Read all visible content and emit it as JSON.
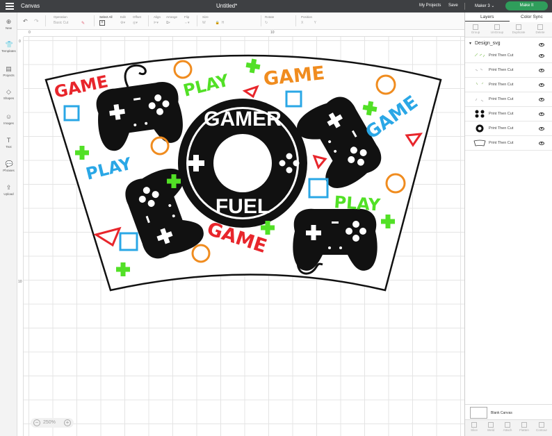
{
  "header": {
    "app_name": "Canvas",
    "document_title": "Untitled*",
    "my_projects": "My Projects",
    "save": "Save",
    "machine": "Maker 3",
    "make_it": "Make It"
  },
  "sidebar": {
    "items": [
      {
        "label": "New",
        "icon": "plus-icon"
      },
      {
        "label": "Templates",
        "icon": "shirt-icon"
      },
      {
        "label": "Projects",
        "icon": "folder-icon"
      },
      {
        "label": "Shapes",
        "icon": "shapes-icon"
      },
      {
        "label": "Images",
        "icon": "image-icon"
      },
      {
        "label": "Text",
        "icon": "text-icon"
      },
      {
        "label": "Phrases",
        "icon": "speech-bubble-icon"
      },
      {
        "label": "Upload",
        "icon": "upload-icon"
      }
    ]
  },
  "toolbar": {
    "operation_label": "Operation",
    "operation_value": "Basic Cut",
    "select_all": "Select All",
    "edit": "Edit",
    "offset": "Offset",
    "align": "Align",
    "arrange": "Arrange",
    "flip": "Flip",
    "size": "Size",
    "rotate": "Rotate",
    "position": "Position",
    "w": "W",
    "h": "H",
    "x": "X",
    "y": "Y"
  },
  "ruler": {
    "top_marks": [
      "0",
      "10"
    ],
    "left_marks": [
      "0",
      "10"
    ]
  },
  "zoom": {
    "value": "250%"
  },
  "design": {
    "center_top": "GAMER",
    "center_bottom": "FUEL",
    "words": [
      {
        "text": "GAME",
        "color": "#e8262c"
      },
      {
        "text": "PLAY",
        "color": "#52e026"
      },
      {
        "text": "GAME",
        "color": "#f08c1f"
      },
      {
        "text": "GAME",
        "color": "#2aa7e6"
      },
      {
        "text": "PLAY",
        "color": "#2aa7e6"
      },
      {
        "text": "PLAY",
        "color": "#52e026"
      },
      {
        "text": "GAME",
        "color": "#e8262c"
      }
    ],
    "colors": {
      "red": "#e8262c",
      "green": "#52e026",
      "orange": "#f08c1f",
      "blue": "#2aa7e6",
      "black": "#111111"
    }
  },
  "panel": {
    "tabs": [
      "Layers",
      "Color Sync"
    ],
    "layer_tools": [
      "Group",
      "UnGroup",
      "Duplicate",
      "Delete"
    ],
    "group_name": "Design_svg",
    "layers": [
      {
        "name": "Print Then Cut",
        "thumb": "thin-strokes"
      },
      {
        "name": "Print Then Cut",
        "thumb": "thin-strokes"
      },
      {
        "name": "Print Then Cut",
        "thumb": "thin-strokes"
      },
      {
        "name": "Print Then Cut",
        "thumb": "thin-strokes"
      },
      {
        "name": "Print Then Cut",
        "thumb": "controllers"
      },
      {
        "name": "Print Then Cut",
        "thumb": "ring"
      },
      {
        "name": "Print Then Cut",
        "thumb": "outline"
      }
    ],
    "blank_canvas": "Blank Canvas",
    "bottom_tools": [
      "Slice",
      "Weld",
      "Attach",
      "Flatten",
      "Contour"
    ]
  }
}
